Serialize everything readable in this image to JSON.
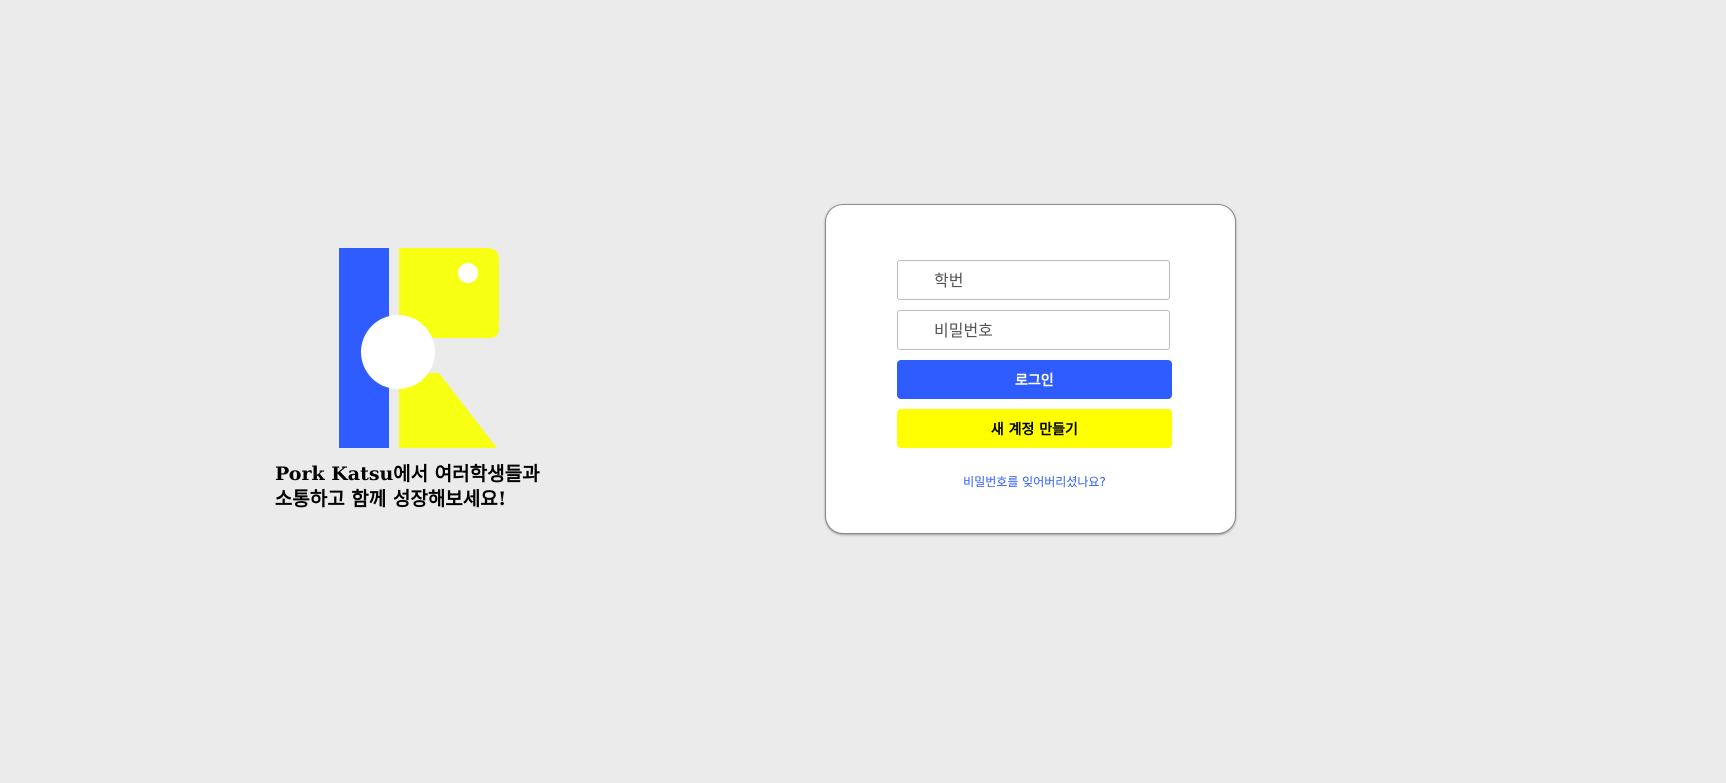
{
  "brand": {
    "tagline": "Pork Katsu에서 여러학생들과\n소통하고 함께 성장해보세요!",
    "logo_colors": {
      "blue": "#2e5cff",
      "yellow": "#f7ff12",
      "white": "#ffffff"
    }
  },
  "login": {
    "student_id_placeholder": "학번",
    "password_placeholder": "비밀번호",
    "login_label": "로그인",
    "signup_label": "새 계정 만들기",
    "forgot_label": "비밀번호를 잊어버리셨나요?"
  },
  "colors": {
    "background": "#ebebeb",
    "accent_blue": "#2e5cff",
    "accent_yellow": "#ffff00"
  }
}
